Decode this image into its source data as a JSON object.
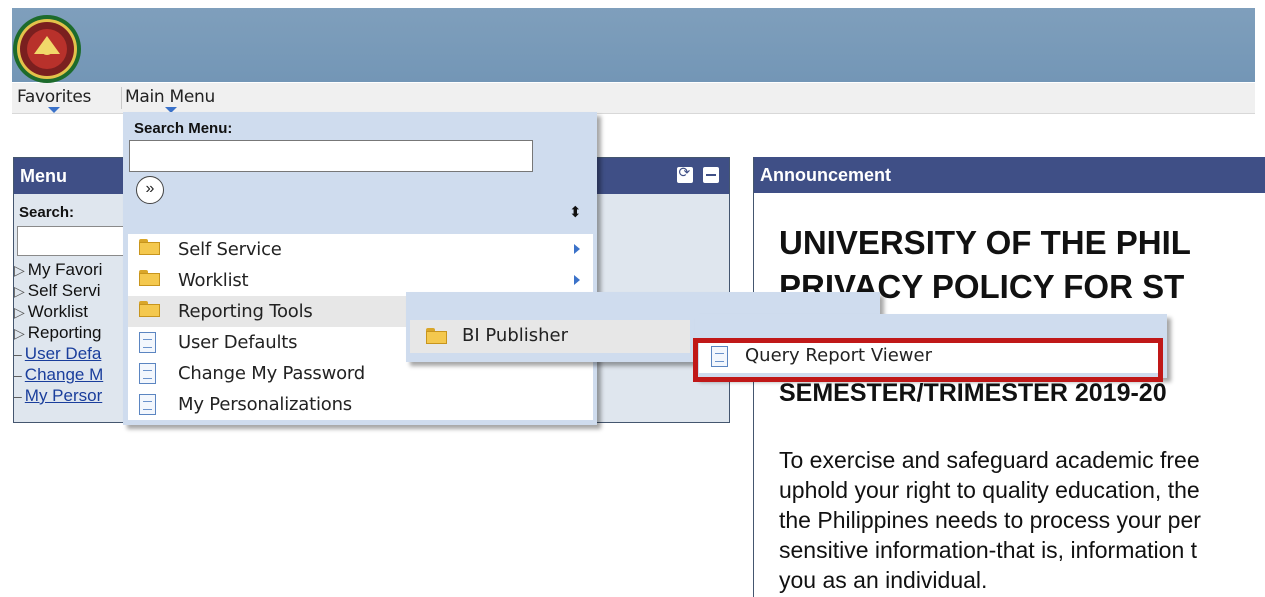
{
  "navbar": {
    "favorites": "Favorites",
    "main_menu": "Main Menu"
  },
  "menu_pagelet": {
    "title": "Menu",
    "search_label": "Search:",
    "items": [
      {
        "marker": "▷",
        "label": "My Favori"
      },
      {
        "marker": "▷",
        "label": "Self Servi"
      },
      {
        "marker": "▷",
        "label": "Worklist"
      },
      {
        "marker": "▷",
        "label": "Reporting"
      },
      {
        "marker": "–",
        "label": "User Defa"
      },
      {
        "marker": "–",
        "label": "Change M"
      },
      {
        "marker": "–",
        "label": "My Persor"
      }
    ]
  },
  "announcement": {
    "title": "Announcement",
    "heading_line1": "UNIVERSITY OF THE PHIL",
    "heading_line2": "PRIVACY POLICY FOR ST",
    "subheading": "SEMESTER/TRIMESTER 2019-20",
    "body": [
      "To exercise and safeguard academic free",
      "uphold your right to quality education, the",
      "the Philippines needs to process your per",
      "sensitive information-that is, information t",
      "you as an individual."
    ]
  },
  "main_menu_dropdown": {
    "search_label": "Search Menu:",
    "search_value": "",
    "go_icon": "double-chevron-right",
    "sort_icon": "sort-icon",
    "items": [
      {
        "label": "Self Service",
        "icon": "folder",
        "has_submenu": true
      },
      {
        "label": "Worklist",
        "icon": "folder",
        "has_submenu": true
      },
      {
        "label": "Reporting Tools",
        "icon": "folder",
        "has_submenu": false,
        "active": true
      },
      {
        "label": "User Defaults",
        "icon": "document",
        "has_submenu": false
      },
      {
        "label": "Change My Password",
        "icon": "document",
        "has_submenu": false
      },
      {
        "label": "My Personalizations",
        "icon": "document",
        "has_submenu": false
      }
    ]
  },
  "reporting_tools_submenu": {
    "items": [
      {
        "label": "BI Publisher",
        "icon": "folder"
      }
    ]
  },
  "bi_publisher_submenu": {
    "items": [
      {
        "label": "Query Report Viewer",
        "icon": "document"
      }
    ]
  },
  "colors": {
    "header_blue": "#3f4f86",
    "banner": "#7a9bb9",
    "highlight_red": "#c01818",
    "arrow_blue": "#3b72c9"
  }
}
